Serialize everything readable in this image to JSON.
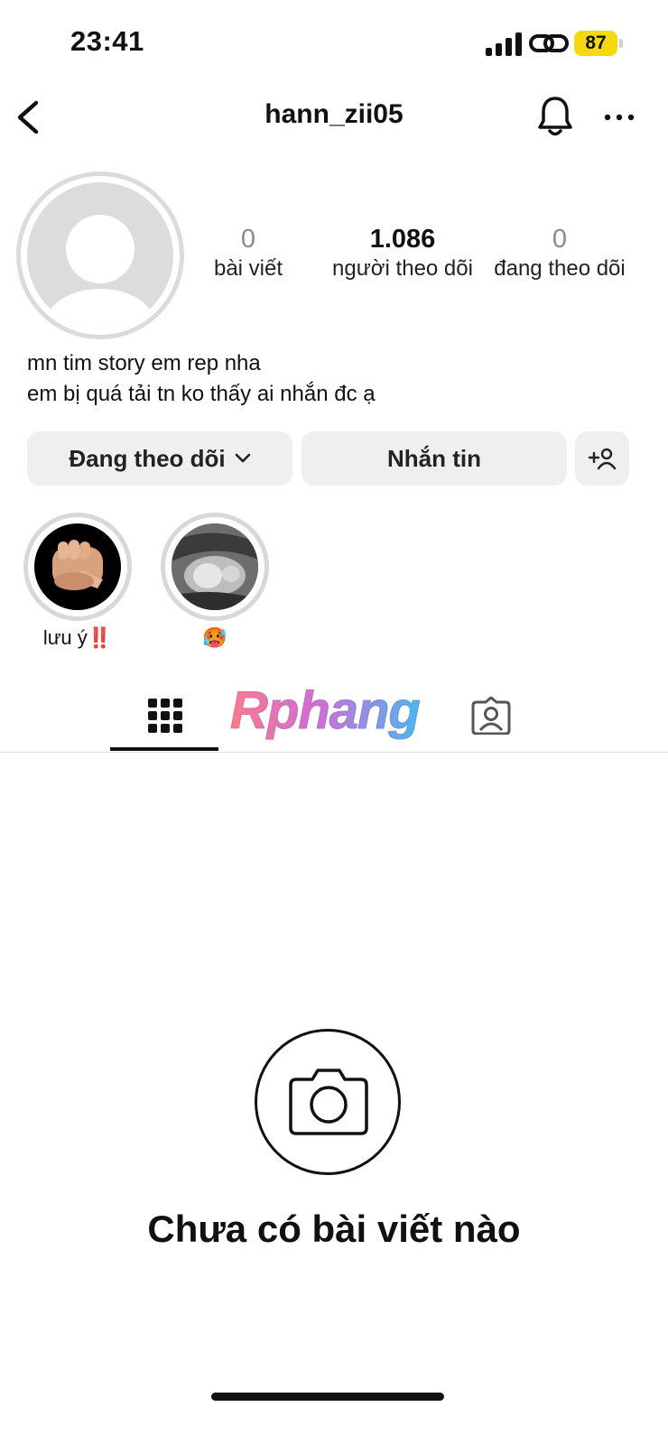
{
  "status_bar": {
    "time": "23:41",
    "battery": "87",
    "battery_color": "#f5d90f",
    "icons": [
      "signal-icon",
      "link-icon",
      "battery-icon"
    ]
  },
  "nav": {
    "back_icon": "chevron-left-icon",
    "username": "hann_zii05",
    "bell_icon": "bell-icon",
    "more_icon": "more-horizontal-icon"
  },
  "profile": {
    "stats": [
      {
        "value": "0",
        "label": "bài viết"
      },
      {
        "value": "1.086",
        "label": "người theo dõi"
      },
      {
        "value": "0",
        "label": "đang theo dõi"
      }
    ],
    "bio_lines": [
      "mn tim story em rep nha",
      "em bị quá tải tn ko thấy ai nhắn đc ạ"
    ]
  },
  "actions": {
    "following_label": "Đang theo dõi",
    "message_label": "Nhắn tin",
    "add_person_icon": "add-person-icon"
  },
  "highlights": [
    {
      "label": "lưu ý‼️"
    },
    {
      "label": "🥵"
    }
  ],
  "tabs": {
    "grid_icon": "grid-icon",
    "tagged_icon": "tagged-person-icon",
    "watermark": "Rphang"
  },
  "empty_state": {
    "icon": "camera-icon",
    "title": "Chưa có bài viết nào"
  }
}
